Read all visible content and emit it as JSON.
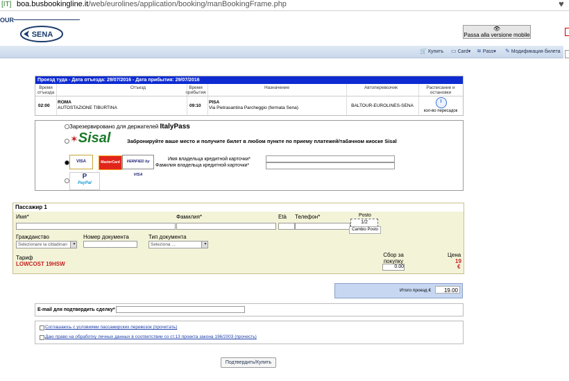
{
  "address_bar": {
    "lang": "[IT]",
    "host": "boa.busbookingline.it",
    "path": "/web/eurolines/application/booking/manBookingFrame.php"
  },
  "header": {
    "our": "OUR",
    "logo": "SENA",
    "mobile": "Passa alla versione mobile"
  },
  "nav": {
    "buy": "Купить",
    "card": "Card",
    "pass": "Pass",
    "modify": "Модификация билета"
  },
  "trip": {
    "bar": "Проезд туда - Дата отъезда: 29/07/2016 - Дата прибытия: 29/07/2016",
    "headers": {
      "dep_time": "Время отъезда",
      "departure": "Отъезд",
      "arr_time": "Время прибытия",
      "destination": "Назначение",
      "carrier": "Автоперевозчик",
      "schedule": "Расписание и остановки"
    },
    "dep_time": "02:00",
    "dep_city": "ROMA",
    "dep_stop": "AUTOSTAZIONE TIBURTINA",
    "arr_time": "09:10",
    "arr_city": "PISA",
    "arr_stop": "Via Pietrasantina Parcheggio (fermata Sena)",
    "carrier": "BALTOUR-EUROLINES-SENA",
    "transfers": "кол-во пересадок"
  },
  "payment": {
    "reserved_label": "Зарезервировано для держателей",
    "italypass": "ItalyPass",
    "sisal_logo": "Sisal",
    "sisal_text": "Забронируйте ваше место и получите билет в любом пункте по приему платежей/табачном киоске Sisal",
    "visa": "VISA",
    "mastercard": "MasterCard",
    "verified": "VERIFIED by VISA",
    "holder_first": "Имя владельца кредитной карточки*",
    "holder_last": "Фамилия владельца кредитной карточки*",
    "paypal": "PayPal"
  },
  "passenger": {
    "title": "Пассажир  1",
    "first_name": "Имя*",
    "last_name": "Фамилия*",
    "age": "Età",
    "phone": "Телефон*",
    "seat_label": "Posto",
    "seat_value": "1/2",
    "change_seat": "Cambio Posto",
    "citizenship": "Гражданство",
    "citizenship_value": "Selezionare la cittadinan",
    "doc_number": "Номер документа",
    "doc_type": "Тип документа",
    "doc_type_value": "Seleziona ...",
    "tariff_label": "Тариф",
    "tariff_value": "LOWCOST 19HSW",
    "fee_label": "Сбор за покупку",
    "fee_value": "0.00",
    "price_label": "Цена",
    "price_value": "19",
    "price_currency": "€"
  },
  "total": {
    "label": "Итого проезд €",
    "value": "19.00"
  },
  "email": {
    "label": "E-mail для подтвердить сделку*"
  },
  "terms": {
    "t1": "Соглашаюсь с условиями пассажирских перевозок (прочитать)",
    "t2": "Даю право на обработку личных данных в соответствии со ст.13 проекта закона 196/2003 (прочесть)"
  },
  "submit": "Подтвердить/Купить"
}
